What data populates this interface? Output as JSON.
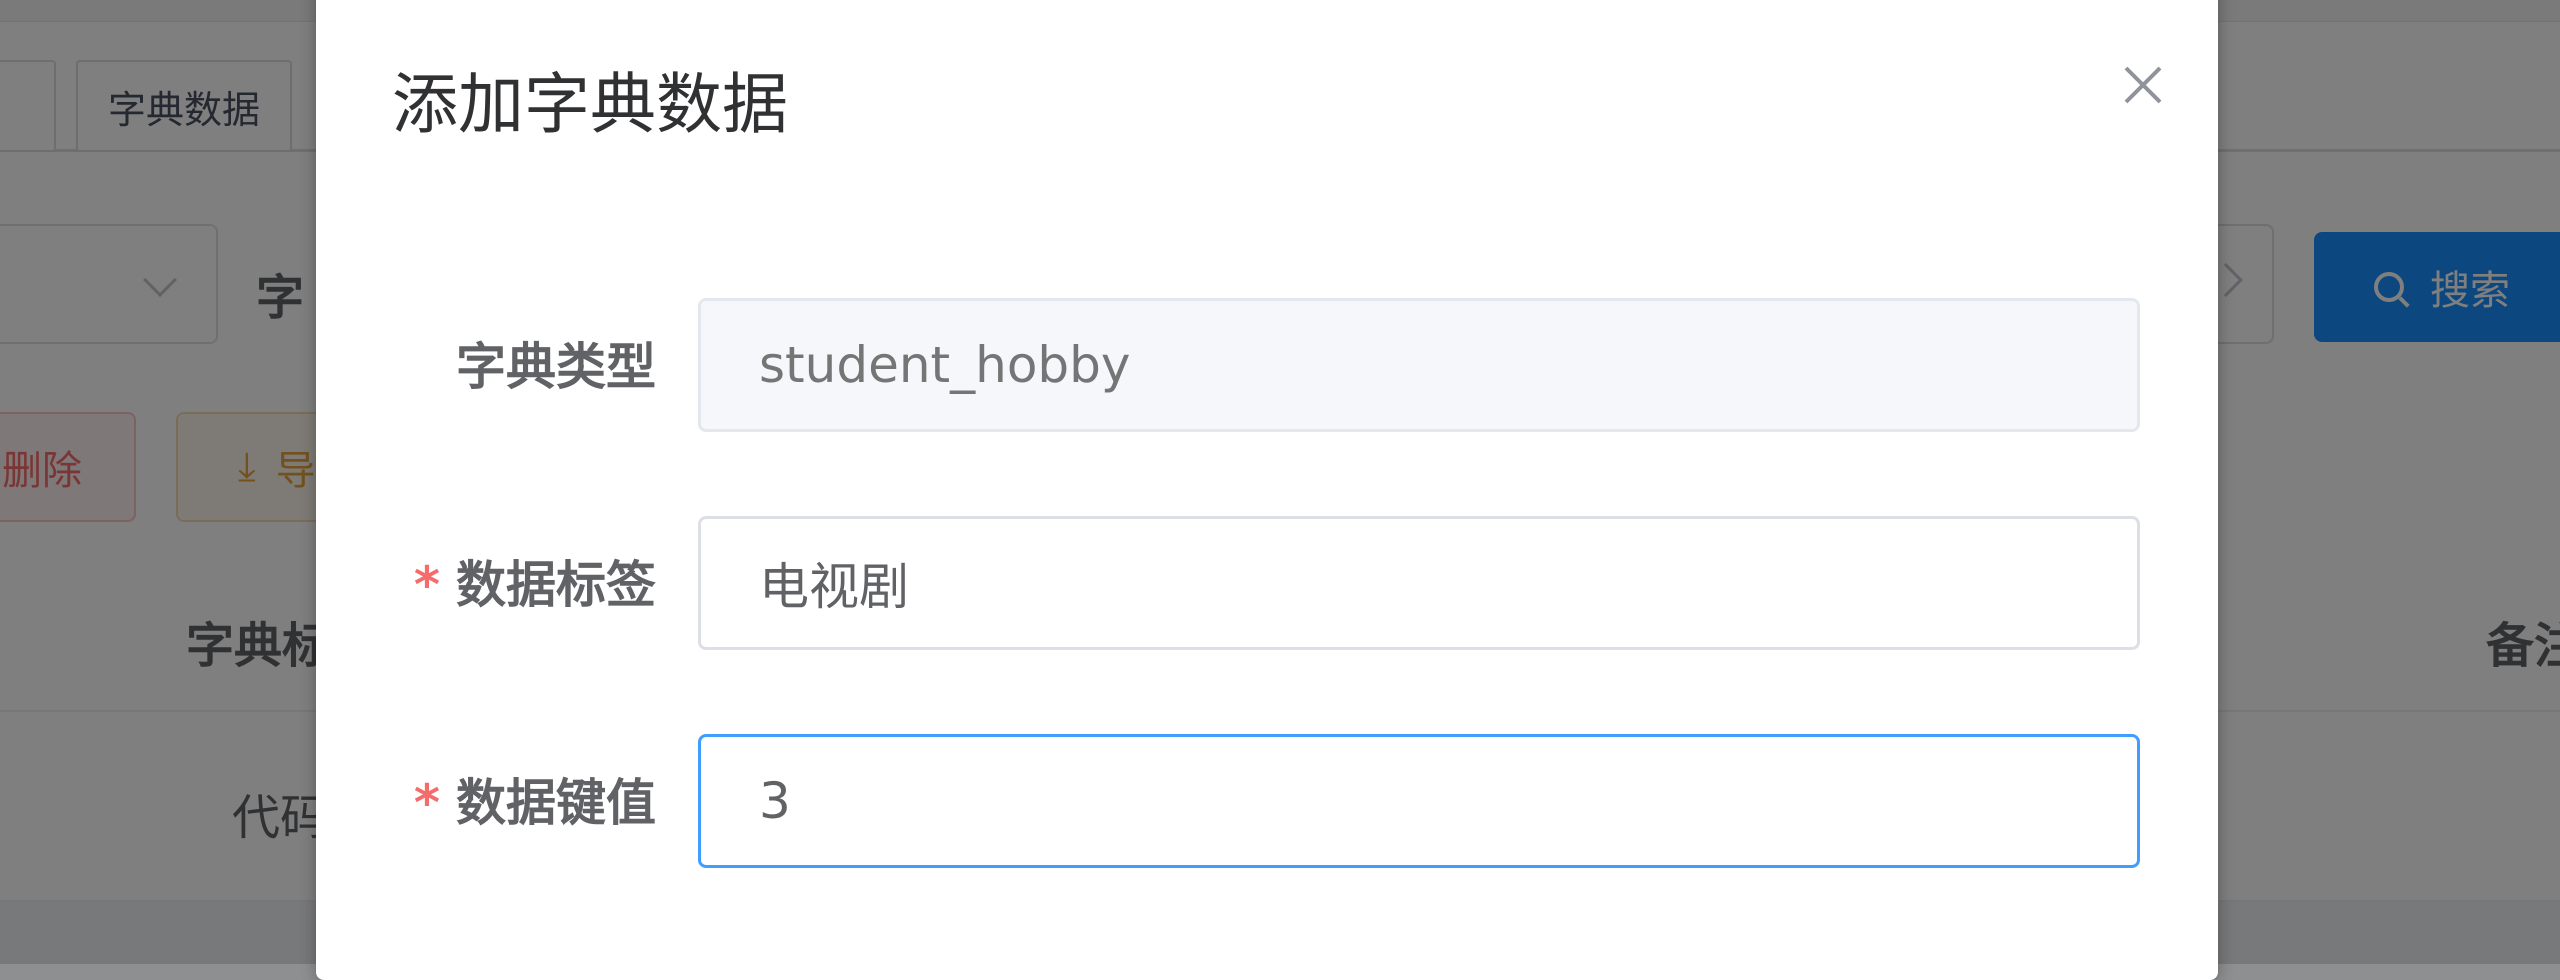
{
  "background": {
    "tags": [
      "字典数据"
    ],
    "filter_label": "字",
    "search_button": "搜索",
    "delete_button": "删除",
    "export_button": "导",
    "table": {
      "header_left": "字典标",
      "header_right": "备注",
      "row_cell": "代码"
    }
  },
  "dialog": {
    "title": "添加字典数据",
    "fields": [
      {
        "label": "字典类型",
        "required": false,
        "value": "",
        "placeholder": "student_hobby",
        "disabled": true
      },
      {
        "label": "数据标签",
        "required": true,
        "value": "电视剧",
        "placeholder": "",
        "disabled": false
      },
      {
        "label": "数据键值",
        "required": true,
        "value": "3",
        "placeholder": "",
        "disabled": false
      }
    ],
    "required_mark": "*"
  },
  "colors": {
    "primary": "#409eff",
    "danger": "#f56c6c",
    "warning": "#e6a23c"
  }
}
